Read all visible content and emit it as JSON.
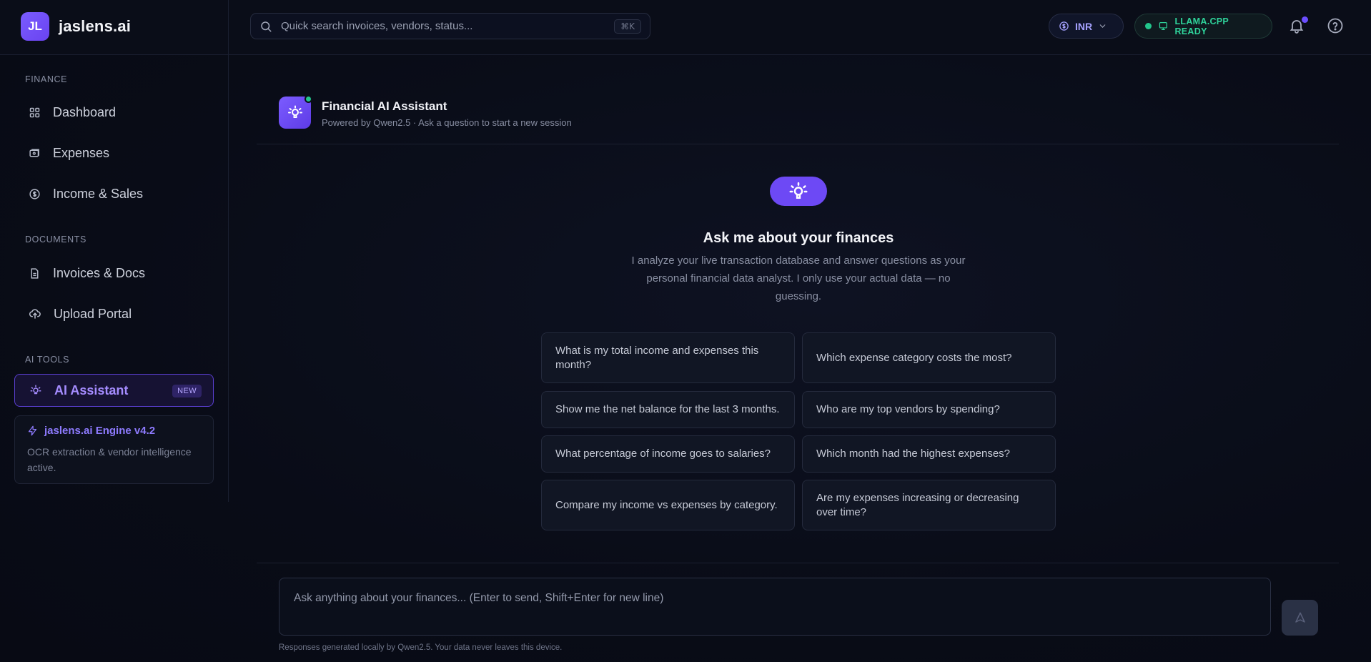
{
  "brand": {
    "logo": "JL",
    "name": "jaslens.ai"
  },
  "search": {
    "placeholder": "Quick search invoices, vendors, status...",
    "shortcut": "⌘K"
  },
  "header": {
    "currency": "INR",
    "engine_status": "LLAMA.CPP READY",
    "colors": {
      "accent": "#6d49f5",
      "status": "#22c58b"
    }
  },
  "sidebar": {
    "sections": [
      {
        "label": "FINANCE"
      },
      {
        "label": "DOCUMENTS"
      },
      {
        "label": "AI TOOLS"
      }
    ],
    "items": [
      {
        "label": "Dashboard",
        "icon": "grid-icon"
      },
      {
        "label": "Expenses",
        "icon": "wallet-icon"
      },
      {
        "label": "Income & Sales",
        "icon": "dollar-circle-icon"
      },
      {
        "label": "Invoices & Docs",
        "icon": "document-icon"
      },
      {
        "label": "Upload Portal",
        "icon": "cloud-upload-icon"
      },
      {
        "label": "AI Assistant",
        "icon": "lightbulb-icon",
        "badge": "NEW",
        "active": true
      }
    ],
    "engine": {
      "title": "jaslens.ai Engine v4.2",
      "description": "OCR extraction & vendor intelligence active."
    }
  },
  "chat": {
    "title": "Financial AI Assistant",
    "subtitle": "Powered by Qwen2.5 · Ask a question to start a new session",
    "hero_title": "Ask me about your finances",
    "hero_description": "I analyze your live transaction database and answer questions as your personal financial data analyst. I only use your actual data — no guessing.",
    "suggestions": [
      "What is my total income and expenses this month?",
      "Which expense category costs the most?",
      "Show me the net balance for the last 3 months.",
      "Who are my top vendors by spending?",
      "What percentage of income goes to salaries?",
      "Which month had the highest expenses?",
      "Compare my income vs expenses by category.",
      "Are my expenses increasing or decreasing over time?"
    ],
    "composer_placeholder": "Ask anything about your finances... (Enter to send, Shift+Enter for new line)",
    "footnote": "Responses generated locally by Qwen2.5. Your data never leaves this device."
  }
}
